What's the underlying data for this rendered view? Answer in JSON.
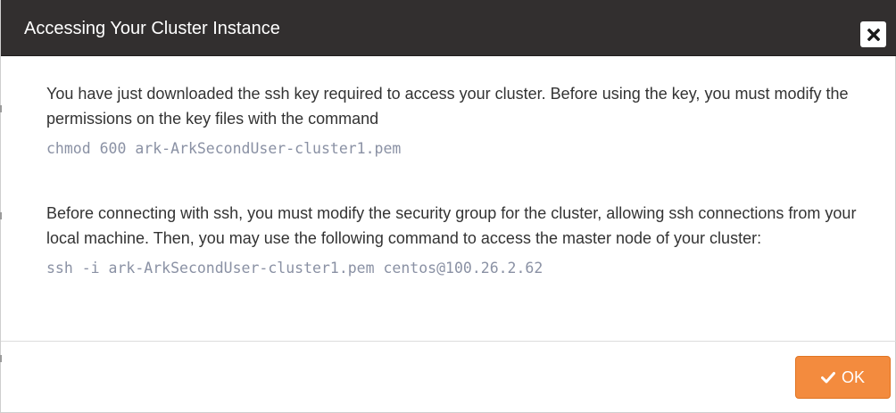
{
  "dialog": {
    "title": "Accessing Your Cluster Instance",
    "close_icon": "close-icon",
    "paragraphs": [
      {
        "text": "You have just downloaded the ssh key required to access your cluster. Before using the key, you must modify the permissions on the key files with the command",
        "command": "chmod 600 ark-ArkSecondUser-cluster1.pem"
      },
      {
        "text": "Before connecting with ssh, you must modify the security group for the cluster, allowing ssh connections from your local machine. Then, you may use the following command to access the master node of your cluster:",
        "command": "ssh -i ark-ArkSecondUser-cluster1.pem centos@100.26.2.62"
      }
    ],
    "ok_label": "OK",
    "ok_icon": "checkmark-icon"
  },
  "colors": {
    "header_bg": "#322f2f",
    "accent": "#f38b3e",
    "code_text": "#8a91a4",
    "body_text": "#333333"
  }
}
